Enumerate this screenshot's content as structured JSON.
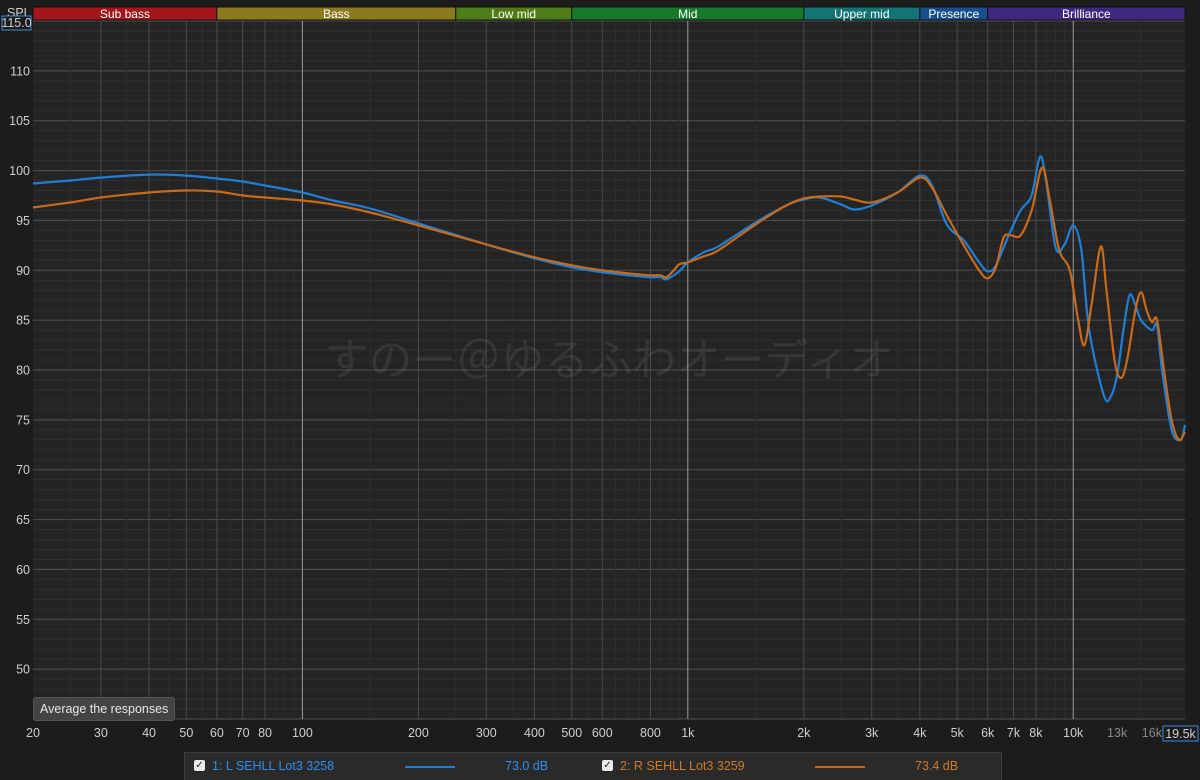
{
  "chart_data": {
    "type": "line",
    "y_axis_title": "SPL",
    "x_axis_scale": "log",
    "xlim": [
      20,
      19500
    ],
    "ylim": [
      45,
      115
    ],
    "y_top_value_label": "115.0",
    "x_right_value_label": "19.5k",
    "y_ticks": [
      50,
      55,
      60,
      65,
      70,
      75,
      80,
      85,
      90,
      95,
      100,
      105,
      110
    ],
    "x_ticks": [
      {
        "value": 20,
        "label": "20",
        "minor": false
      },
      {
        "value": 30,
        "label": "30",
        "minor": false
      },
      {
        "value": 40,
        "label": "40",
        "minor": false
      },
      {
        "value": 50,
        "label": "50",
        "minor": false
      },
      {
        "value": 60,
        "label": "60",
        "minor": false
      },
      {
        "value": 70,
        "label": "70",
        "minor": false
      },
      {
        "value": 80,
        "label": "80",
        "minor": false
      },
      {
        "value": 100,
        "label": "100",
        "minor": false
      },
      {
        "value": 200,
        "label": "200",
        "minor": false
      },
      {
        "value": 300,
        "label": "300",
        "minor": false
      },
      {
        "value": 400,
        "label": "400",
        "minor": false
      },
      {
        "value": 500,
        "label": "500",
        "minor": false
      },
      {
        "value": 600,
        "label": "600",
        "minor": false
      },
      {
        "value": 800,
        "label": "800",
        "minor": false
      },
      {
        "value": 1000,
        "label": "1k",
        "minor": false
      },
      {
        "value": 2000,
        "label": "2k",
        "minor": false
      },
      {
        "value": 3000,
        "label": "3k",
        "minor": false
      },
      {
        "value": 4000,
        "label": "4k",
        "minor": false
      },
      {
        "value": 5000,
        "label": "5k",
        "minor": false
      },
      {
        "value": 6000,
        "label": "6k",
        "minor": false
      },
      {
        "value": 7000,
        "label": "7k",
        "minor": false
      },
      {
        "value": 8000,
        "label": "8k",
        "minor": false
      },
      {
        "value": 10000,
        "label": "10k",
        "minor": false
      },
      {
        "value": 13000,
        "label": "13k",
        "minor": true
      },
      {
        "value": 16000,
        "label": "16k",
        "minor": true
      }
    ],
    "bands": [
      {
        "name": "Sub bass",
        "from": 20,
        "to": 60,
        "color": "#a3161b"
      },
      {
        "name": "Bass",
        "from": 60,
        "to": 250,
        "color": "#8c7a1c"
      },
      {
        "name": "Low mid",
        "from": 250,
        "to": 500,
        "color": "#4e7d16"
      },
      {
        "name": "Mid",
        "from": 500,
        "to": 2000,
        "color": "#177a2a"
      },
      {
        "name": "Upper mid",
        "from": 2000,
        "to": 4000,
        "color": "#127474"
      },
      {
        "name": "Presence",
        "from": 4000,
        "to": 6000,
        "color": "#1a4f8e"
      },
      {
        "name": "Brilliance",
        "from": 6000,
        "to": 19500,
        "color": "#3e2880"
      }
    ],
    "watermark": "すのー＠ゆるふわオーディオ",
    "series": [
      {
        "name": "1: L SEHLL Lot3 3258",
        "color": "#1e7fd8",
        "points": [
          [
            20,
            98.7
          ],
          [
            25,
            99
          ],
          [
            30,
            99.3
          ],
          [
            40,
            99.6
          ],
          [
            50,
            99.5
          ],
          [
            60,
            99.2
          ],
          [
            70,
            98.9
          ],
          [
            80,
            98.5
          ],
          [
            100,
            97.8
          ],
          [
            120,
            97
          ],
          [
            150,
            96.2
          ],
          [
            200,
            94.7
          ],
          [
            300,
            92.6
          ],
          [
            400,
            91.2
          ],
          [
            500,
            90.3
          ],
          [
            600,
            89.8
          ],
          [
            700,
            89.5
          ],
          [
            800,
            89.3
          ],
          [
            850,
            89.3
          ],
          [
            880,
            89.1
          ],
          [
            950,
            89.9
          ],
          [
            1000,
            90.8
          ],
          [
            1100,
            91.8
          ],
          [
            1200,
            92.4
          ],
          [
            1500,
            94.8
          ],
          [
            1800,
            96.5
          ],
          [
            2000,
            97.1
          ],
          [
            2200,
            97.3
          ],
          [
            2500,
            96.6
          ],
          [
            2700,
            96.1
          ],
          [
            3000,
            96.5
          ],
          [
            3500,
            97.8
          ],
          [
            4000,
            99.5
          ],
          [
            4300,
            98.5
          ],
          [
            4700,
            94.6
          ],
          [
            5200,
            93
          ],
          [
            5700,
            90.8
          ],
          [
            6000,
            89.9
          ],
          [
            6300,
            90.5
          ],
          [
            6800,
            93.5
          ],
          [
            7300,
            96
          ],
          [
            7800,
            97.5
          ],
          [
            8200,
            101.4
          ],
          [
            8500,
            99
          ],
          [
            9000,
            92.3
          ],
          [
            9500,
            92.6
          ],
          [
            10000,
            94.5
          ],
          [
            10500,
            92
          ],
          [
            11000,
            84
          ],
          [
            12000,
            77.5
          ],
          [
            12500,
            77.3
          ],
          [
            13000,
            79.5
          ],
          [
            13500,
            84
          ],
          [
            14000,
            87.5
          ],
          [
            14500,
            86.5
          ],
          [
            15000,
            85
          ],
          [
            16000,
            84
          ],
          [
            16500,
            84.5
          ],
          [
            17000,
            80
          ],
          [
            18000,
            74
          ],
          [
            19000,
            73
          ],
          [
            19500,
            74.5
          ]
        ]
      },
      {
        "name": "2: R SEHLL Lot3 3259",
        "color": "#c96a1a",
        "points": [
          [
            20,
            96.3
          ],
          [
            25,
            96.8
          ],
          [
            30,
            97.3
          ],
          [
            40,
            97.8
          ],
          [
            50,
            98
          ],
          [
            60,
            97.9
          ],
          [
            70,
            97.5
          ],
          [
            80,
            97.3
          ],
          [
            100,
            97
          ],
          [
            120,
            96.6
          ],
          [
            150,
            95.8
          ],
          [
            200,
            94.5
          ],
          [
            300,
            92.6
          ],
          [
            400,
            91.3
          ],
          [
            500,
            90.5
          ],
          [
            600,
            90
          ],
          [
            700,
            89.7
          ],
          [
            800,
            89.5
          ],
          [
            850,
            89.5
          ],
          [
            880,
            89.3
          ],
          [
            920,
            90
          ],
          [
            950,
            90.6
          ],
          [
            1000,
            90.8
          ],
          [
            1100,
            91.4
          ],
          [
            1200,
            92
          ],
          [
            1500,
            94.6
          ],
          [
            1800,
            96.5
          ],
          [
            2000,
            97.2
          ],
          [
            2200,
            97.4
          ],
          [
            2500,
            97.4
          ],
          [
            2700,
            97.1
          ],
          [
            3000,
            96.8
          ],
          [
            3500,
            97.8
          ],
          [
            4000,
            99.3
          ],
          [
            4300,
            98.3
          ],
          [
            4700,
            95.5
          ],
          [
            5200,
            92.5
          ],
          [
            5700,
            90
          ],
          [
            6000,
            89.2
          ],
          [
            6300,
            90.3
          ],
          [
            6600,
            93.3
          ],
          [
            6900,
            93.5
          ],
          [
            7300,
            93.5
          ],
          [
            7800,
            96
          ],
          [
            8300,
            100.3
          ],
          [
            8700,
            97
          ],
          [
            9200,
            92
          ],
          [
            9800,
            90
          ],
          [
            10300,
            85
          ],
          [
            10700,
            82.5
          ],
          [
            11200,
            87
          ],
          [
            11800,
            92.4
          ],
          [
            12200,
            88
          ],
          [
            12800,
            81
          ],
          [
            13300,
            79.2
          ],
          [
            13800,
            81
          ],
          [
            14500,
            86
          ],
          [
            15000,
            87.8
          ],
          [
            15500,
            86
          ],
          [
            16000,
            84.8
          ],
          [
            16500,
            85
          ],
          [
            17200,
            80
          ],
          [
            18000,
            75
          ],
          [
            18800,
            73
          ],
          [
            19500,
            73.8
          ]
        ]
      }
    ]
  },
  "ui": {
    "average_button_label": "Average the responses",
    "legend": [
      {
        "check": "✓",
        "name": "1: L SEHLL Lot3 3258",
        "level": "73.0 dB",
        "color": "#1e7fd8"
      },
      {
        "check": "✓",
        "name": "2: R SEHLL Lot3 3259",
        "level": "73.4 dB",
        "color": "#c96a1a"
      }
    ]
  }
}
